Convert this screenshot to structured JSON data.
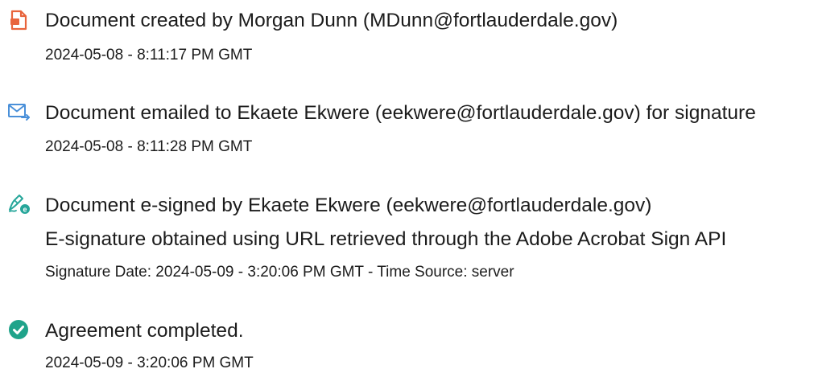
{
  "events": [
    {
      "icon": "document-created-icon",
      "title": "Document created by Morgan Dunn (MDunn@fortlauderdale.gov)",
      "timestamp": "2024-05-08 - 8:11:17 PM GMT"
    },
    {
      "icon": "email-sent-icon",
      "title": "Document emailed to Ekaete Ekwere (eekwere@fortlauderdale.gov) for signature",
      "timestamp": "2024-05-08 - 8:11:28 PM GMT"
    },
    {
      "icon": "e-signed-icon",
      "title": "Document e-signed by Ekaete Ekwere (eekwere@fortlauderdale.gov)",
      "detail": "E-signature obtained using URL retrieved through the Adobe Acrobat Sign API",
      "timestamp": "Signature Date: 2024-05-09 - 3:20:06 PM GMT - Time Source: server"
    },
    {
      "icon": "agreement-completed-icon",
      "title": "Agreement completed.",
      "timestamp": "2024-05-09 - 3:20:06 PM GMT"
    }
  ],
  "colors": {
    "created_icon": "#e8643c",
    "email_icon": "#4a90d9",
    "signed_icon": "#26a69a",
    "completed_icon": "#1fa38a",
    "text": "#1c1c1c"
  }
}
